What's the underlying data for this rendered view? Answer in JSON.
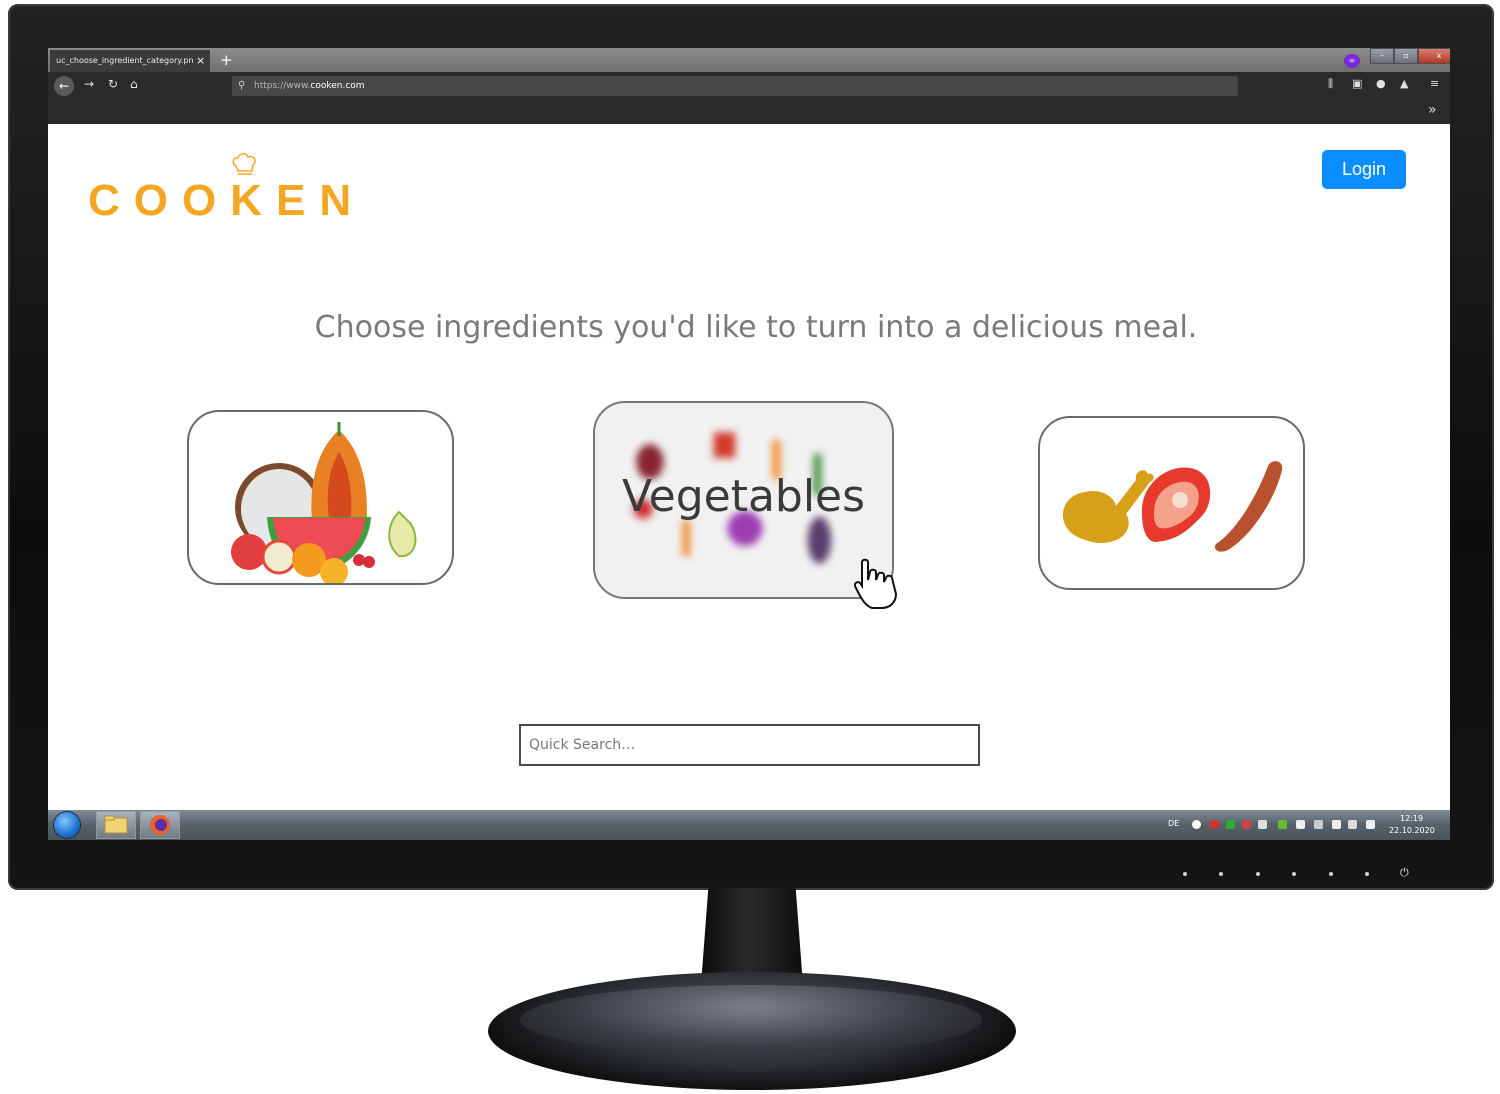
{
  "browser": {
    "tab_title": "uc_choose_ingredient_category.pn",
    "tab_close": "×",
    "new_tab": "+",
    "url_prefix": "https://www.",
    "url_domain": "cooken.com",
    "window_buttons": [
      "–",
      "▫",
      "x"
    ],
    "overflow": "»"
  },
  "site": {
    "logo_text": "COOKEN",
    "login_label": "Login",
    "headline": "Choose ingredients you'd like to turn into a delicious meal.",
    "categories": [
      {
        "id": "fruits",
        "label": ""
      },
      {
        "id": "vegetables",
        "label": "Vegetables"
      },
      {
        "id": "meat",
        "label": ""
      }
    ],
    "search": {
      "placeholder": "Quick Search…",
      "value": ""
    }
  },
  "taskbar": {
    "language": "DE",
    "time": "12:19",
    "date": "22.10.2020"
  },
  "colors": {
    "brand": "#f5a623",
    "login": "#0a8dff"
  }
}
